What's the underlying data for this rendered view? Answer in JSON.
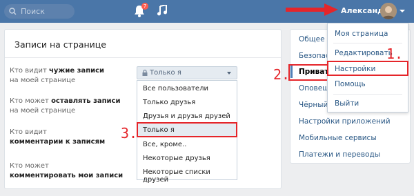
{
  "header": {
    "search_placeholder": "Поиск",
    "notification_count": "7",
    "user_name": "Александр"
  },
  "card": {
    "title": "Записи на странице",
    "rows": [
      {
        "l1_plain": "Кто видит ",
        "l1_bold": "чужие записи",
        "l2": "на моей странице"
      },
      {
        "l1_plain": "Кто может ",
        "l1_bold": "оставлять записи",
        "l2": "на моей странице"
      },
      {
        "l1_plain": "Кто видит",
        "l1_bold": "",
        "l2_bold": "комментарии к записям"
      },
      {
        "l1_plain": "Кто может",
        "l1_bold": "",
        "l2_bold": "комментировать мои записи"
      }
    ],
    "select_value": "Только я",
    "options": [
      "Все пользователи",
      "Только друзья",
      "Друзья и друзья друзей",
      "Только я",
      "Все, кроме..",
      "Некоторые друзья",
      "Некоторые списки друзей"
    ]
  },
  "rightnav": {
    "items": [
      "Общее",
      "Безопасность",
      "Приватность",
      "Оповещения",
      "Чёрный список",
      "Настройки приложений",
      "Мобильные сервисы",
      "Платежи и переводы"
    ]
  },
  "user_menu": {
    "items": [
      "Моя страница",
      "Редактировать",
      "Настройки",
      "Помощь",
      "Выйти"
    ]
  },
  "annotations": {
    "n1": "1.",
    "n2": "2.",
    "n3": "3."
  },
  "colors": {
    "header": "#4a76a8",
    "annotation": "#e5252a",
    "link": "#2a5885"
  }
}
